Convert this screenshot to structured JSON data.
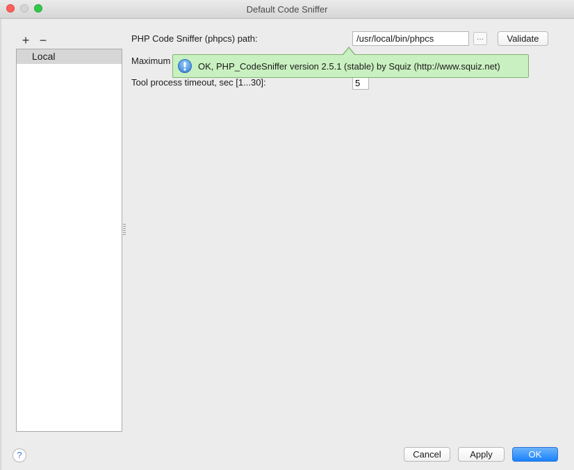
{
  "window": {
    "title": "Default Code Sniffer"
  },
  "toolbar": {
    "add_symbol": "+",
    "remove_symbol": "−"
  },
  "list": {
    "items": [
      {
        "label": "Local",
        "selected": true
      }
    ]
  },
  "form": {
    "path_label": "PHP Code Sniffer (phpcs) path:",
    "path_value": "/usr/local/bin/phpcs",
    "browse_label": "...",
    "validate_label": "Validate",
    "max_label": "Maximum",
    "timeout_label": "Tool process timeout, sec [1...30]:",
    "timeout_value": "5"
  },
  "tooltip": {
    "text": "OK, PHP_CodeSniffer version 2.5.1 (stable) by Squiz (http://www.squiz.net)",
    "icon": "info-icon",
    "background": "#c9f0c0"
  },
  "footer": {
    "help_symbol": "?",
    "cancel_label": "Cancel",
    "apply_label": "Apply",
    "ok_label": "OK"
  },
  "colors": {
    "primary_button": "#1a82fb",
    "selection": "#d6d6d6"
  }
}
